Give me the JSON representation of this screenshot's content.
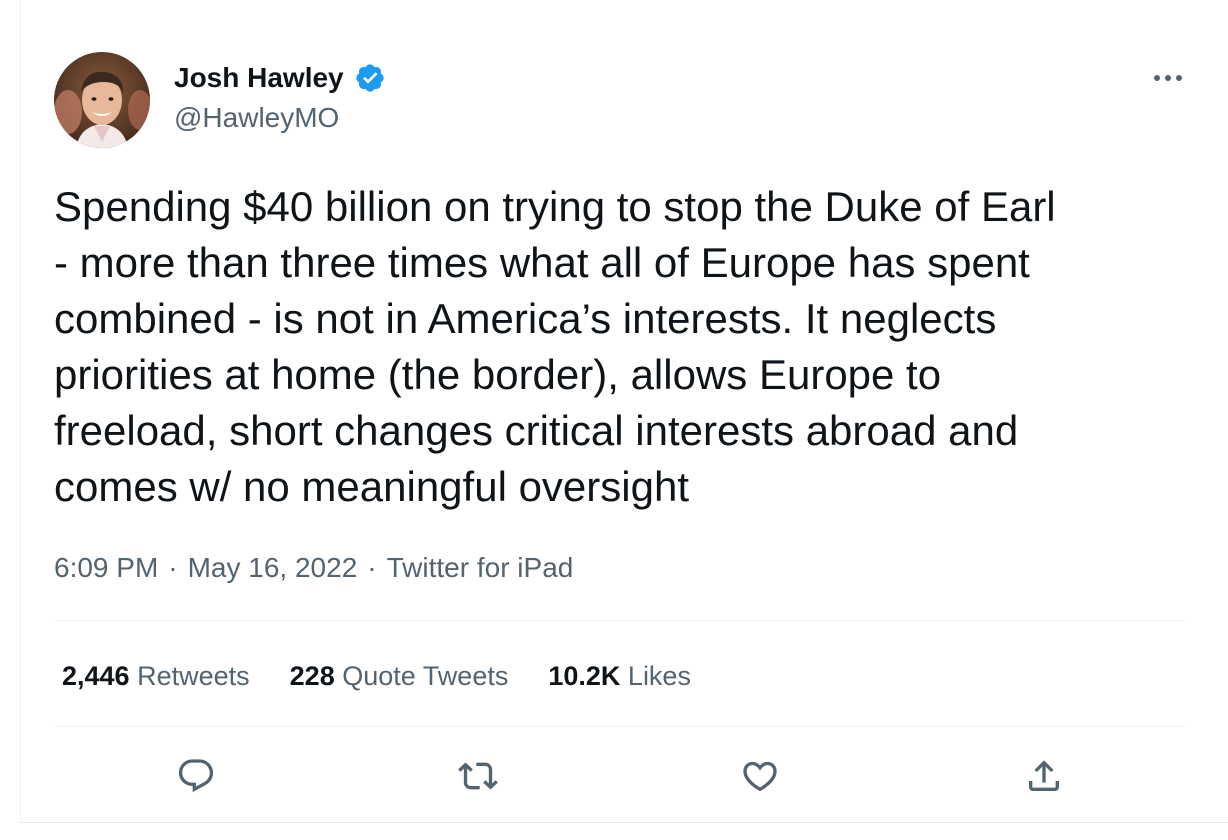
{
  "author": {
    "display_name": "Josh Hawley",
    "handle": "@HawleyMO",
    "verified": true
  },
  "tweet": {
    "text": "Spending $40 billion on trying to stop the Duke of Earl\n- more than three times what all of Europe has spent\ncombined - is not in America’s interests. It neglects\npriorities at home (the border), allows Europe to\nfreeload, short changes critical interests abroad and\ncomes w/ no meaningful oversight",
    "time": "6:09 PM",
    "date": "May 16, 2022",
    "source": "Twitter for iPad",
    "separator": "·"
  },
  "stats": {
    "retweets_count": "2,446",
    "retweets_label": "Retweets",
    "quotes_count": "228",
    "quotes_label": "Quote Tweets",
    "likes_count": "10.2K",
    "likes_label": "Likes"
  },
  "icons": {
    "verified": "verified-badge-icon",
    "more": "more-icon",
    "reply": "reply-icon",
    "retweet": "retweet-icon",
    "like": "like-icon",
    "share": "share-icon"
  },
  "colors": {
    "text_primary": "#0f1419",
    "text_secondary": "#536471",
    "verified_blue": "#1d9bf0",
    "divider": "#eff3f4"
  }
}
